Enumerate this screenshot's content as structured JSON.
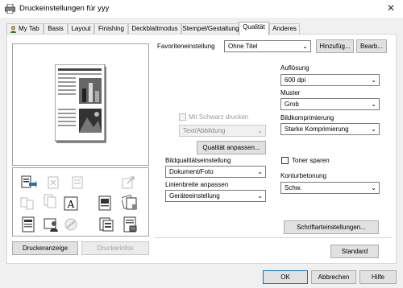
{
  "window": {
    "title": "Druckeinstellungen für yyy",
    "close_symbol": "✕"
  },
  "tabs": [
    {
      "label": "My Tab",
      "active": false
    },
    {
      "label": "Basis",
      "active": false
    },
    {
      "label": "Layout",
      "active": false
    },
    {
      "label": "Finishing",
      "active": false
    },
    {
      "label": "Deckblattmodus",
      "active": false
    },
    {
      "label": "Stempel/Gestaltung",
      "active": false
    },
    {
      "label": "Qualität",
      "active": true
    },
    {
      "label": "Anderes",
      "active": false
    }
  ],
  "favorites": {
    "label": "Favoriteneinstellung",
    "value": "Ohne Titel",
    "add_button": "Hinzufüg...",
    "edit_button": "Bearb..."
  },
  "left_panel": {
    "printer_view_button": "Druckeranzeige",
    "printer_info_button": "Druckerinfos"
  },
  "quality": {
    "bw_checkbox_label": "Mit Schwarz drucken",
    "bw_checked": false,
    "text_mode_value": "Text/Abbildung",
    "adjust_button": "Qualität anpassen...",
    "image_quality_label": "Bildqualitätseinstellung",
    "image_quality_value": "Dokument/Foto",
    "line_width_label": "Linienbreite anpassen",
    "line_width_value": "Geräteeinstellung"
  },
  "right_settings": {
    "resolution_label": "Auflösung",
    "resolution_value": "600 dpi",
    "pattern_label": "Muster",
    "pattern_value": "Grob",
    "compression_label": "Bildkomprimierung",
    "compression_value": "Starke Komprimierung",
    "toner_save_label": "Toner sparen",
    "toner_save_checked": false,
    "contour_label": "Konturbetonung",
    "contour_value": "Schw.",
    "font_settings_button": "Schriftarteinstellungen..."
  },
  "standard_button": "Standard",
  "footer": {
    "ok": "OK",
    "cancel": "Abbrechen",
    "help": "Hilfe"
  },
  "colors": {
    "accent": "#0078d7",
    "tab_border": "#adadad",
    "panel_border": "#d9d9d9"
  }
}
